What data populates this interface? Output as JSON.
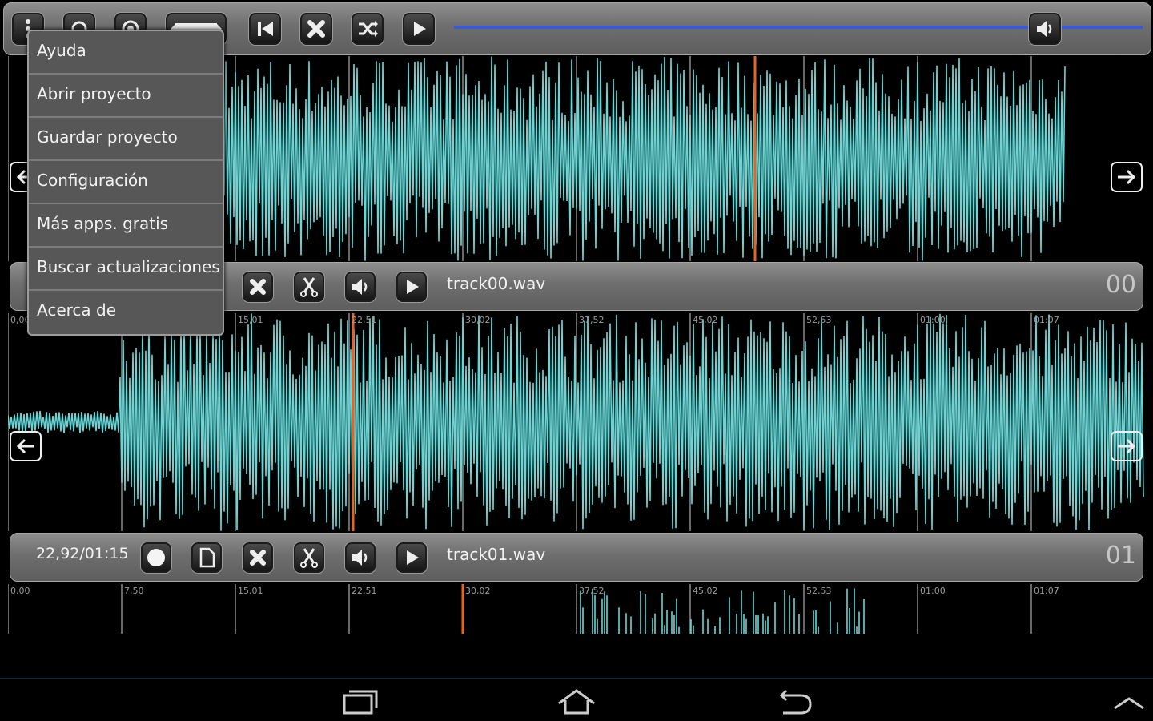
{
  "menu": {
    "items": [
      {
        "label": "Ayuda"
      },
      {
        "label": "Abrir proyecto"
      },
      {
        "label": "Guardar proyecto"
      },
      {
        "label": "Configuración"
      },
      {
        "label": "Más apps. gratis"
      },
      {
        "label": "Buscar actualizaciones"
      },
      {
        "label": "Acerca de"
      }
    ]
  },
  "header": {
    "volume_level": 0.93,
    "accent": "#3a58d8"
  },
  "tracks": [
    {
      "name": "track00.wav",
      "number": "00",
      "time": ""
    },
    {
      "name": "track01.wav",
      "number": "01",
      "time": "22,92/01:15"
    }
  ],
  "timeline": {
    "ticks": [
      "0,00",
      "7,50",
      "15,01",
      "22,51",
      "30,02",
      "37,52",
      "45,02",
      "52,53",
      "01:00",
      "01:07"
    ]
  },
  "colors": {
    "waveform": "#66d6d6",
    "playhead": "#e8641e",
    "panel": "#6e6e6e",
    "background": "#000000"
  }
}
